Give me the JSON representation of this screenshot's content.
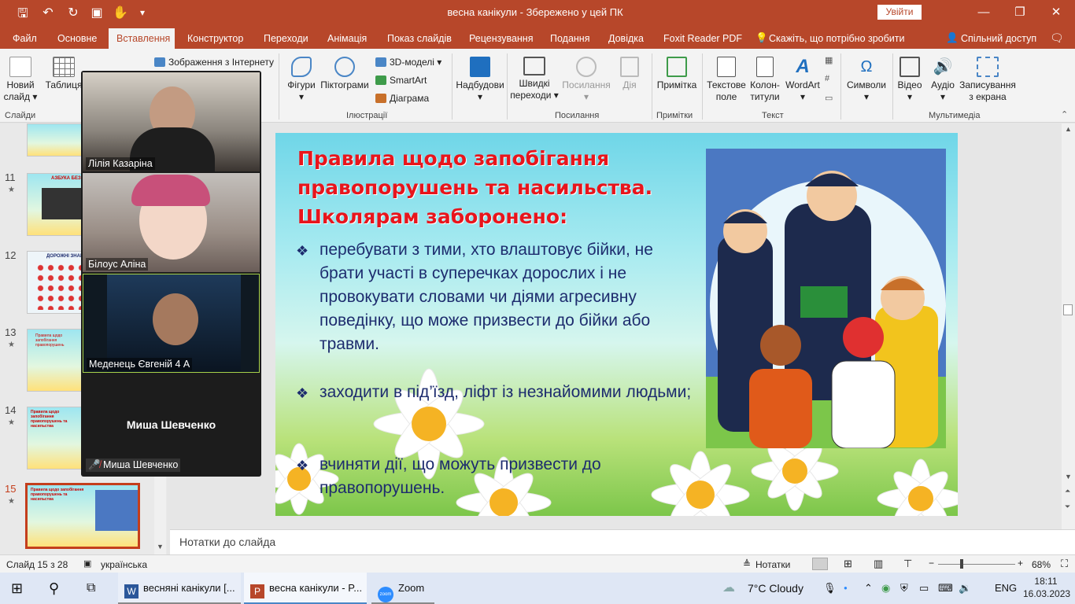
{
  "window": {
    "doc_title": "весна канікули  -  Збережено у цей ПК",
    "signin_label": "Увійти"
  },
  "tabs": [
    {
      "label": "Файл"
    },
    {
      "label": "Основне"
    },
    {
      "label": "Вставлення"
    },
    {
      "label": "Конструктор"
    },
    {
      "label": "Переходи"
    },
    {
      "label": "Анімація"
    },
    {
      "label": "Показ слайдів"
    },
    {
      "label": "Рецензування"
    },
    {
      "label": "Подання"
    },
    {
      "label": "Довідка"
    },
    {
      "label": "Foxit Reader PDF"
    },
    {
      "label": "Скажіть, що потрібно зробити"
    }
  ],
  "share_label": "Спільний доступ",
  "ribbon": {
    "new_slide_1": "Новий",
    "new_slide_2": "слайд",
    "table": "Таблиця",
    "online_pictures": "Зображення з Інтернету",
    "shapes": "Фігури",
    "icons": "Піктограми",
    "models_3d": "3D-моделі",
    "smartart": "SmartArt",
    "chart": "Діаграма",
    "addins": "Надбудови",
    "zoom_1": "Швидкі",
    "zoom_2": "переходи",
    "link": "Посилання",
    "action": "Дія",
    "comment": "Примітка",
    "textbox_1": "Текстове",
    "textbox_2": "поле",
    "header_1": "Колон-",
    "header_2": "титули",
    "wordart": "WordArt",
    "symbols": "Символи",
    "video": "Відео",
    "audio": "Аудіо",
    "screenrec_1": "Записування",
    "screenrec_2": "з екрана",
    "group_slides": "Слайди",
    "group_illustrations": "Ілюстрації",
    "group_links": "Посилання",
    "group_comments": "Примітки",
    "group_text": "Текст",
    "group_media": "Мультимедіа"
  },
  "thumbnails": [
    {
      "num": "11",
      "star": "★",
      "text": "АЗБУКА БЕЗПЕКИ ПОРУЧ ТЕБЕ"
    },
    {
      "num": "12",
      "star": "",
      "text": "ДОРОЖНІ ЗНАКИ"
    },
    {
      "num": "13",
      "star": "★",
      "text": "Правила щодо запобігання правопорушень"
    },
    {
      "num": "14",
      "star": "★",
      "text": "Правила щодо запобігання правопорушень та насильства"
    },
    {
      "num": "15",
      "star": "★",
      "text": "Правила щодо запобігання правопорушень та насильства"
    }
  ],
  "slide": {
    "title_1": "Правила щодо запобігання",
    "title_2": "правопорушень та насильства.",
    "title_3": "Школярам заборонено:",
    "bullet_mark": "❖",
    "bullet_1": "перебувати з тими, хто влаштовує бійки, не брати участі в суперечках дорослих і не провокувати словами чи діями агресивну поведінку, що може призвести до бійки або травми.",
    "bullet_2": "заходити в під’їзд, ліфт із незнайомими людьми;",
    "bullet_3": "вчиняти дії, що можуть призвести до правопорушень."
  },
  "notes_placeholder": "Нотатки до слайда",
  "zoom": {
    "p1": "Лілія Казаріна",
    "p2": "Білоус Аліна",
    "p3": "Меденець Євгеній 4 А",
    "p4_center": "Миша Шевченко",
    "p4": "Миша Шевченко"
  },
  "status": {
    "slide_count": "Слайд 15 з 28",
    "language": "українська",
    "notes": "Нотатки",
    "zoom": "68%"
  },
  "taskbar": {
    "word": "весняні канікули [...",
    "ppt": "весна канікули - P...",
    "zoom": "Zoom",
    "weather": "7°C  Cloudy",
    "lang": "ENG",
    "time": "18:11",
    "date": "16.03.2023"
  },
  "colors": {
    "accent": "#b7472a",
    "slide_title": "#e8151c",
    "slide_text": "#1d2c6e"
  }
}
